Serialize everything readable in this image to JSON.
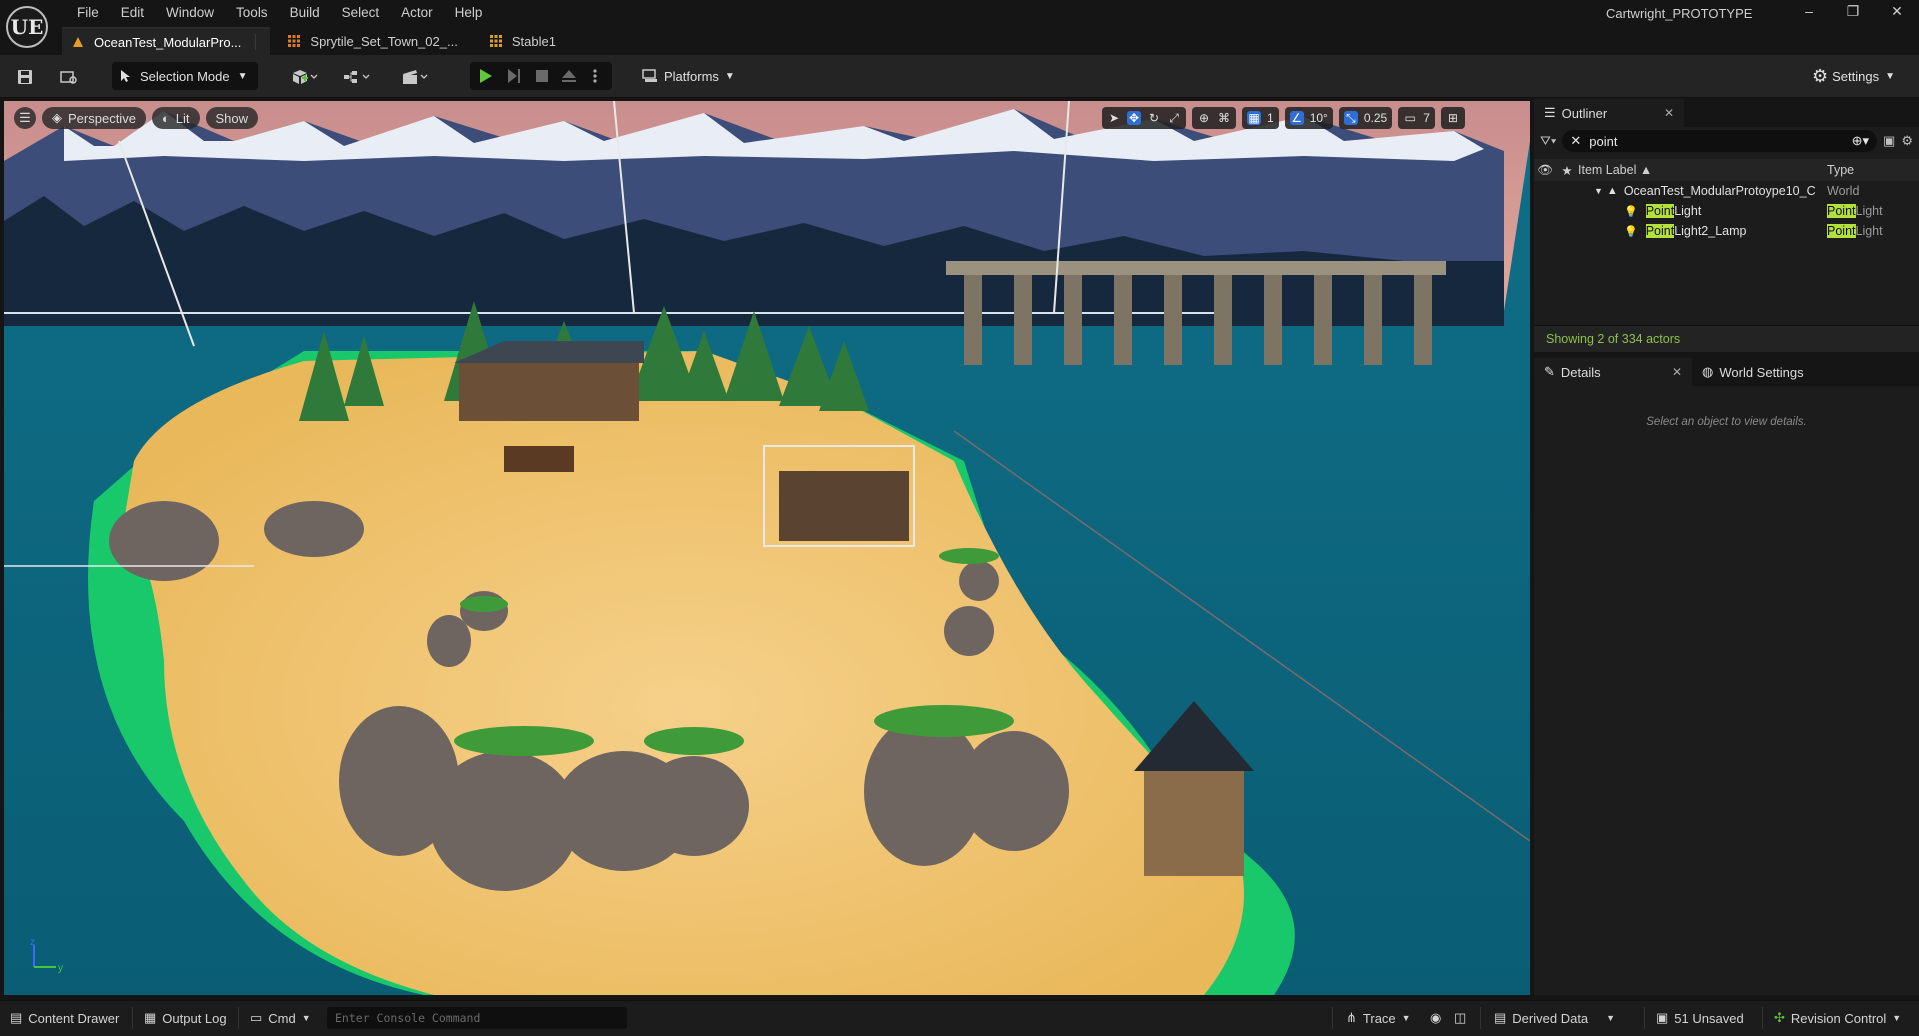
{
  "app": {
    "logo": "UE",
    "window_title": "Cartwright_PROTOTYPE",
    "window_controls": [
      "–",
      "❐",
      "✕"
    ]
  },
  "menu": [
    "File",
    "Edit",
    "Window",
    "Tools",
    "Build",
    "Select",
    "Actor",
    "Help"
  ],
  "tabs": [
    {
      "label": "OceanTest_ModularPro...",
      "icon": "level-icon",
      "color": "#e89c2c"
    },
    {
      "label": "Sprytile_Set_Town_02_...",
      "icon": "grid-asset-icon",
      "color": "#e07a1c"
    },
    {
      "label": "Stable1",
      "icon": "grid-asset-icon",
      "color": "#e0a01c"
    }
  ],
  "toolbar": {
    "selection_mode": "Selection Mode",
    "platforms": "Platforms",
    "settings": "Settings"
  },
  "viewport": {
    "perspective": "Perspective",
    "lit": "Lit",
    "show": "Show",
    "grid_snap": "1",
    "rotation_snap": "10°",
    "scale_snap": "0.25",
    "camera_speed": "7",
    "axis_y": "y",
    "accent": "#2d6fd6"
  },
  "outliner": {
    "title": "Outliner",
    "search_value": "point",
    "col_label": "Item Label ▲",
    "col_type": "Type",
    "world_row": {
      "label": "OceanTest_ModularProtoype10_C",
      "type": "World"
    },
    "rows": [
      {
        "match": "Point",
        "rest": "Light",
        "type_match": "Point",
        "type_rest": "Light"
      },
      {
        "match": "Point",
        "rest": "Light2_Lamp",
        "type_match": "Point",
        "type_rest": "Light"
      }
    ],
    "showing": "Showing 2 of 334 actors",
    "highlight_color": "#b4e03c"
  },
  "details": {
    "tab": "Details",
    "world_settings": "World Settings",
    "hint": "Select an object to view details."
  },
  "statusbar": {
    "content_drawer": "Content Drawer",
    "output_log": "Output Log",
    "cmd": "Cmd",
    "console_placeholder": "Enter Console Command",
    "trace": "Trace",
    "derived_data": "Derived Data",
    "unsaved": "51 Unsaved",
    "revision_control": "Revision Control"
  }
}
